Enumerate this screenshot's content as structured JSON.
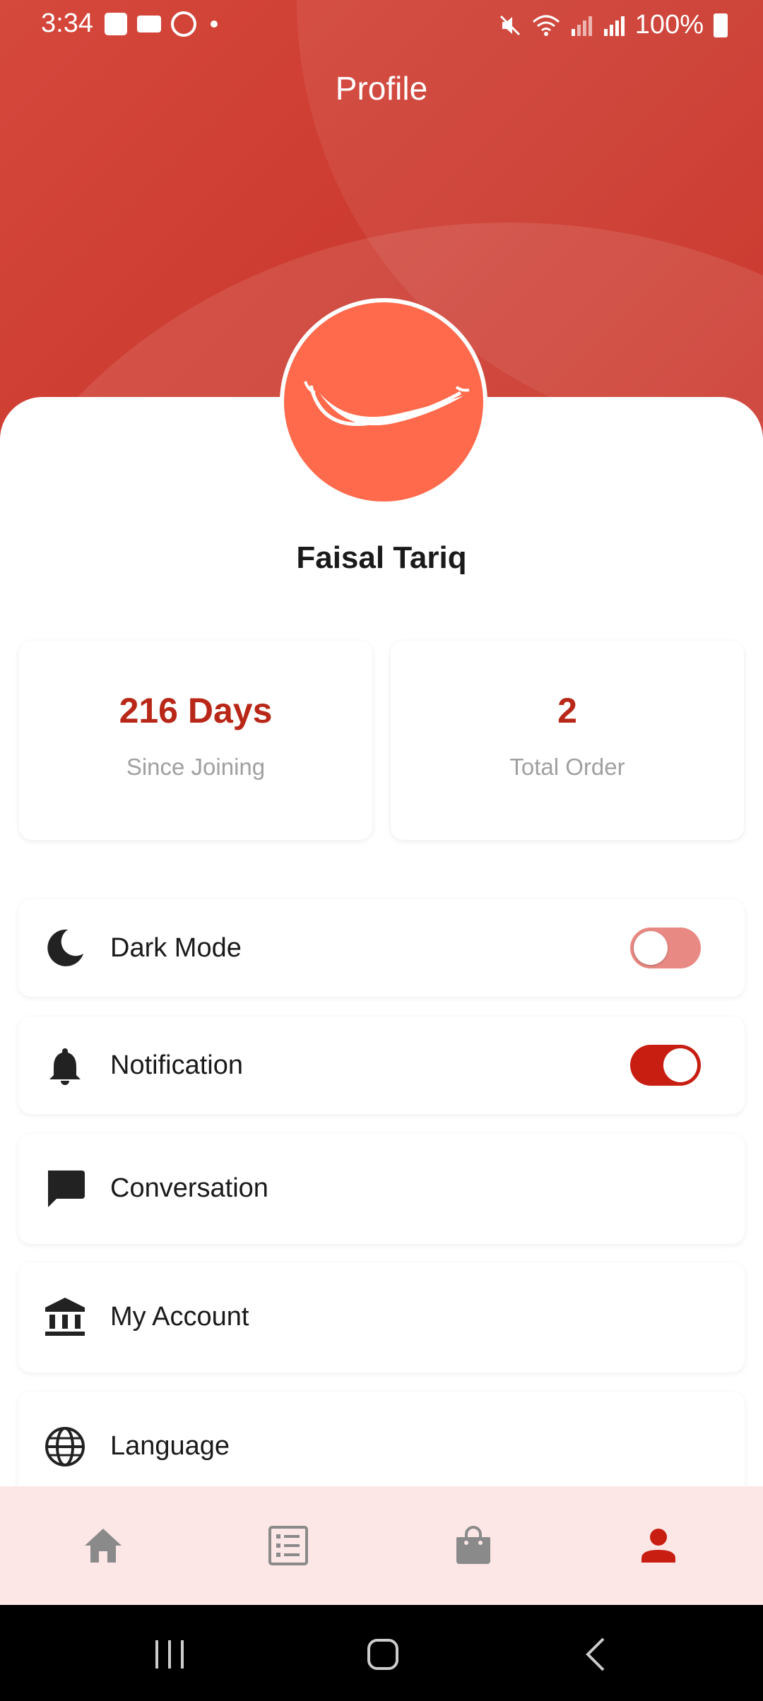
{
  "status_bar": {
    "time": "3:34",
    "battery": "100%"
  },
  "header": {
    "title": "Profile"
  },
  "profile": {
    "name": "Faisal Tariq"
  },
  "stats": [
    {
      "value": "216 Days",
      "label": "Since Joining"
    },
    {
      "value": "2",
      "label": "Total Order"
    }
  ],
  "menu": [
    {
      "label": "Dark Mode",
      "icon": "moon-icon",
      "toggle": "off"
    },
    {
      "label": "Notification",
      "icon": "bell-icon",
      "toggle": "on"
    },
    {
      "label": "Conversation",
      "icon": "chat-bubble-icon"
    },
    {
      "label": "My Account",
      "icon": "bank-icon"
    },
    {
      "label": "Language",
      "icon": "globe-icon"
    }
  ],
  "bottom_nav": [
    {
      "icon": "home-icon",
      "active": false
    },
    {
      "icon": "orders-list-icon",
      "active": false
    },
    {
      "icon": "shopping-bag-icon",
      "active": false
    },
    {
      "icon": "person-icon",
      "active": true
    }
  ],
  "colors": {
    "accent": "#b82717",
    "header": "#cc3a2f",
    "avatar": "#ff6a4c",
    "nav_bg": "#fde7e6",
    "nav_inactive": "#8a8a8a",
    "nav_active": "#c81e12"
  }
}
